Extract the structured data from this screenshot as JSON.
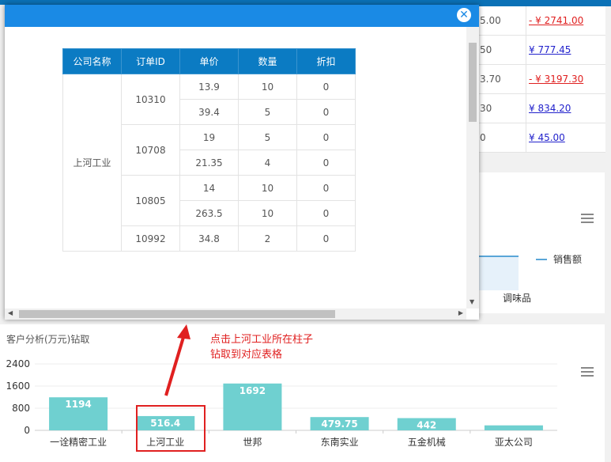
{
  "background_table": {
    "rows": [
      {
        "qty": "5.00",
        "amount": "- ¥ 2741.00",
        "negative": true
      },
      {
        "qty": "50",
        "amount": "¥ 777.45",
        "negative": false
      },
      {
        "qty": "3.70",
        "amount": "- ¥ 3197.30",
        "negative": true
      },
      {
        "qty": "30",
        "amount": "¥ 834.20",
        "negative": false
      },
      {
        "qty": "0",
        "amount": "¥ 45.00",
        "negative": false
      }
    ]
  },
  "mid_chart": {
    "legend": "销售额",
    "xlabel": "调味品"
  },
  "popup": {
    "close_label": "✕",
    "columns": [
      "公司名称",
      "订单ID",
      "单价",
      "数量",
      "折扣"
    ],
    "company": "上河工业",
    "orders": [
      {
        "id": "10310",
        "lines": [
          {
            "price": "13.9",
            "qty": "10",
            "discount": "0"
          },
          {
            "price": "39.4",
            "qty": "5",
            "discount": "0"
          }
        ]
      },
      {
        "id": "10708",
        "lines": [
          {
            "price": "19",
            "qty": "5",
            "discount": "0"
          },
          {
            "price": "21.35",
            "qty": "4",
            "discount": "0"
          }
        ]
      },
      {
        "id": "10805",
        "lines": [
          {
            "price": "14",
            "qty": "10",
            "discount": "0"
          },
          {
            "price": "263.5",
            "qty": "10",
            "discount": "0"
          }
        ]
      },
      {
        "id": "10992",
        "lines": [
          {
            "price": "34.8",
            "qty": "2",
            "discount": "0"
          }
        ]
      }
    ]
  },
  "bottom_panel": {
    "title": "客户分析(万元)钻取",
    "annotation_line1": "点击上河工业所在柱子",
    "annotation_line2": "钻取到对应表格"
  },
  "chart_data": {
    "type": "bar",
    "title": "客户分析(万元)钻取",
    "categories": [
      "一诠精密工业",
      "上河工业",
      "世邦",
      "东南实业",
      "五金机械",
      "亚太公司"
    ],
    "values": [
      1194,
      516.4,
      1692,
      479.75,
      442,
      180
    ],
    "data_labels": [
      "1194",
      "516.4",
      "1692",
      "479.75",
      "442",
      ""
    ],
    "yticks": [
      "0",
      "800",
      "1600",
      "2400"
    ],
    "ylim": [
      0,
      2400
    ],
    "bar_color": "#6fd0d0",
    "highlight_category": "上河工业"
  }
}
